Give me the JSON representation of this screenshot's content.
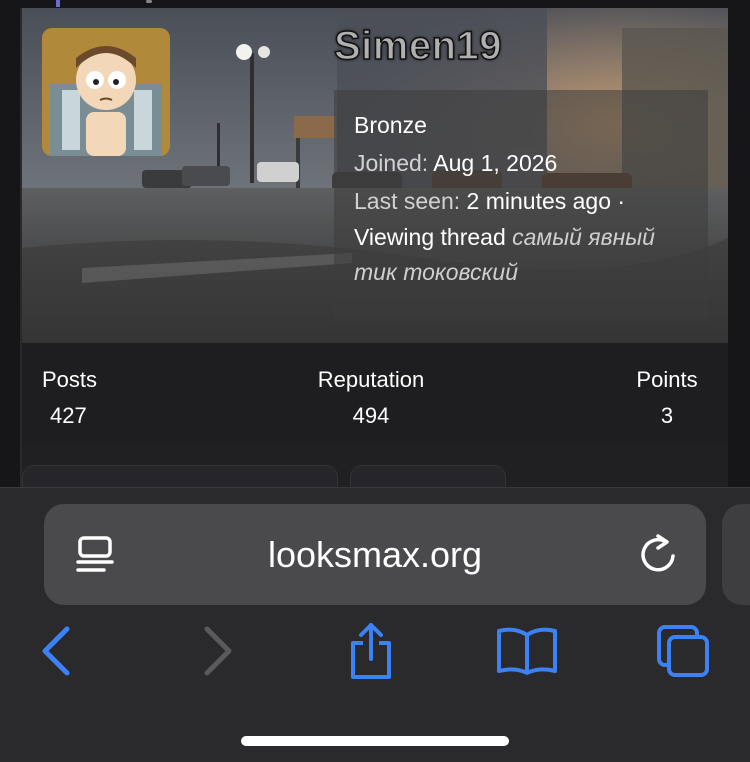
{
  "profile": {
    "username": "Simen19",
    "rank": "Bronze",
    "joined_label": "Joined:",
    "joined_value": "Aug 1, 2026",
    "last_seen_label": "Last seen:",
    "last_seen_value": "2 minutes ago ·",
    "activity_prefix": "Viewing thread",
    "activity_thread": "самый явный тик токовский"
  },
  "stats": [
    {
      "label": "Posts",
      "value": "427"
    },
    {
      "label": "Reputation",
      "value": "494"
    },
    {
      "label": "Points",
      "value": "3"
    }
  ],
  "browser": {
    "url": "looksmax.org",
    "icons": {
      "reader": "reader-icon",
      "reload": "reload-icon",
      "back": "back-icon",
      "forward": "forward-icon",
      "share": "share-icon",
      "bookmarks": "bookmarks-icon",
      "tabs": "tabs-icon"
    },
    "accent_color": "#3b82f6",
    "disabled_color": "#5a5a5e"
  }
}
